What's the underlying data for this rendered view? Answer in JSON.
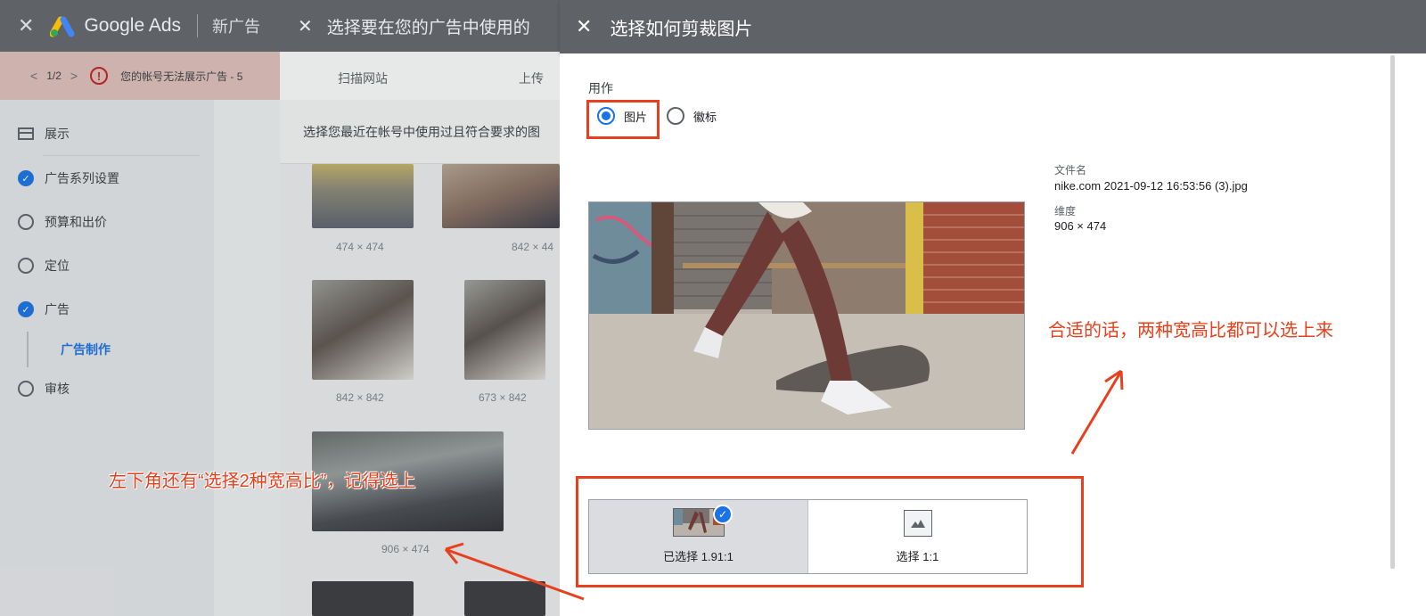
{
  "app": {
    "close_glyph": "✕",
    "logo_text": "Google Ads",
    "campaign_title": "新广告"
  },
  "notice": {
    "page": "1/2",
    "prev_glyph": "<",
    "next_glyph": ">",
    "warn_glyph": "!",
    "text": "您的帐号无法展示广告 - 5"
  },
  "nav": {
    "items": [
      {
        "label": "展示",
        "icon": "display-icon",
        "state": "icon"
      },
      {
        "label": "广告系列设置",
        "icon": "check-icon",
        "state": "done"
      },
      {
        "label": "预算和出价",
        "icon": "circle-icon",
        "state": "todo"
      },
      {
        "label": "定位",
        "icon": "circle-icon",
        "state": "todo"
      },
      {
        "label": "广告",
        "icon": "check-icon",
        "state": "done"
      },
      {
        "label": "审核",
        "icon": "circle-icon",
        "state": "todo"
      }
    ],
    "sub_item": "广告制作"
  },
  "media_dialog": {
    "title": "选择要在您的广告中使用的",
    "tab_scan": "扫描网站",
    "tab_upload": "上传",
    "info": "选择您最近在帐号中使用过且符合要求的图",
    "dims": [
      "474 × 474",
      "842 × 44",
      "842 × 842",
      "673 × 842",
      "906 × 474"
    ]
  },
  "crop_dialog": {
    "title": "选择如何剪裁图片",
    "usage_label": "用作",
    "radio_image": "图片",
    "radio_logo": "徽标",
    "file_name_label": "文件名",
    "file_name": "nike.com 2021-09-12 16:53:56 (3).jpg",
    "dimension_label": "维度",
    "dimension": "906 × 474",
    "ratio_selected": "已选择 1.91:1",
    "ratio_square": "选择 1:1",
    "check_glyph": "✓"
  },
  "annotations": {
    "left": "左下角还有“选择2种宽高比”，记得选上",
    "right": "合适的话，两种宽高比都可以选上来"
  },
  "colors": {
    "accent": "#1a73e8",
    "annotation": "#e8401c",
    "topbar": "#5f6368"
  }
}
